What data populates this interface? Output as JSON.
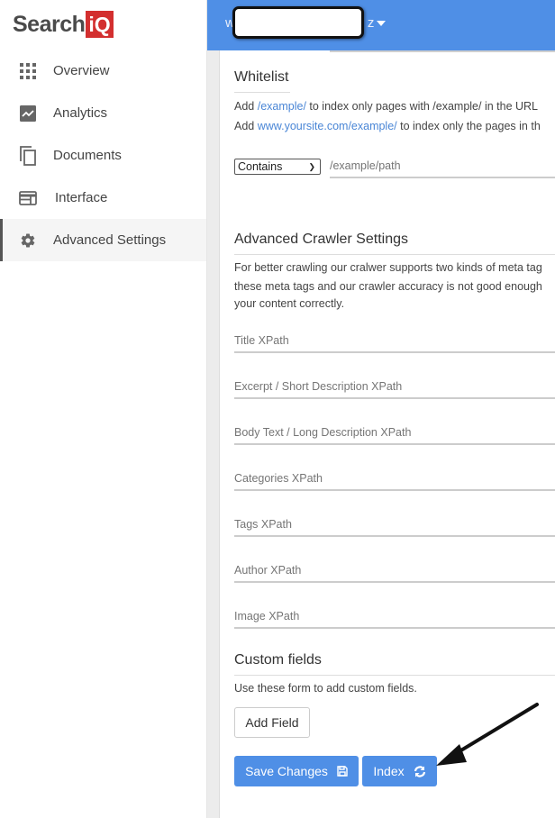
{
  "brand": {
    "word": "Search",
    "badge": "iQ",
    "badge_color": "#d32f2f"
  },
  "header": {
    "account_prefix": "w",
    "account_suffix": "z",
    "bg_color": "#4f8fe6"
  },
  "sidebar": {
    "items": [
      {
        "label": "Overview",
        "icon": "grid-icon"
      },
      {
        "label": "Analytics",
        "icon": "chart-icon"
      },
      {
        "label": "Documents",
        "icon": "documents-icon"
      },
      {
        "label": "Interface",
        "icon": "interface-icon"
      },
      {
        "label": "Advanced Settings",
        "icon": "gear-icon",
        "active": true
      }
    ]
  },
  "whitelist": {
    "title": "Whitelist",
    "line1": {
      "pre": "Add ",
      "link": "/example/",
      "post": " to index only pages with /example/ in the URL"
    },
    "line2": {
      "pre": "Add ",
      "link": "www.yoursite.com/example/",
      "post": " to index only the pages in th"
    },
    "match_select": "Contains",
    "path_placeholder": "/example/path"
  },
  "crawler": {
    "title": "Advanced Crawler Settings",
    "desc_lines": [
      "For better crawling our cralwer supports two kinds of meta tag",
      "these meta tags and our crawler accuracy is not good enough",
      "your content correctly."
    ],
    "fields": [
      {
        "placeholder": "Title XPath"
      },
      {
        "placeholder": "Excerpt / Short Description XPath"
      },
      {
        "placeholder": "Body Text / Long Description XPath"
      },
      {
        "placeholder": "Categories XPath"
      },
      {
        "placeholder": "Tags XPath"
      },
      {
        "placeholder": "Author XPath"
      },
      {
        "placeholder": "Image XPath"
      }
    ]
  },
  "custom_fields": {
    "title": "Custom fields",
    "desc": "Use these form to add custom fields.",
    "add_button": "Add Field"
  },
  "actions": {
    "save_label": "Save Changes",
    "index_label": "Index",
    "button_color": "#4f8fe6"
  }
}
